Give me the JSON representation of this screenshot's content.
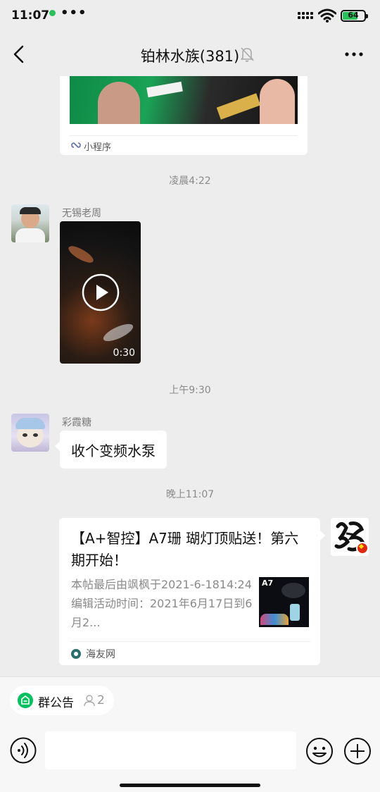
{
  "status_bar": {
    "time": "11:07",
    "battery": "64",
    "dots": "•••"
  },
  "nav": {
    "title": "铂林水族(381)",
    "back_icon": "chevron-left-icon",
    "mute_icon": "bell-off-icon",
    "more_icon": "more-dots-icon"
  },
  "messages": {
    "mini_program_card": {
      "label": "小程序"
    },
    "ts1": "凌晨4:22",
    "video_msg": {
      "sender": "无锡老周",
      "duration": "0:30"
    },
    "ts2": "上午9:30",
    "text_msg": {
      "sender": "彩霞糖",
      "text": "收个变频水泵"
    },
    "ts3": "晚上11:07",
    "link_card": {
      "title": "【A+智控】A7珊 瑚灯顶贴送！第六期开始！",
      "desc": "本帖最后由飒枫于2021-6-1814:24编辑活动时间：2021年6月17日到6月2...",
      "thumb_text": "A7",
      "source": "海友网"
    }
  },
  "bottom": {
    "notice_label": "群公告",
    "notice_count": "2",
    "input_placeholder": ""
  },
  "colors": {
    "accent": "#07c160",
    "background": "#ededed"
  }
}
